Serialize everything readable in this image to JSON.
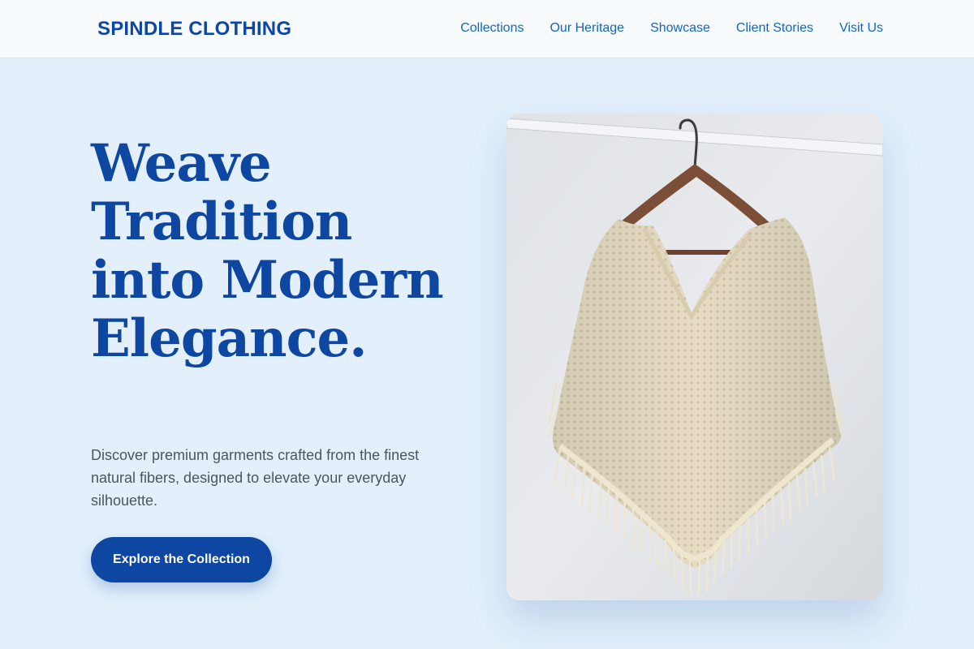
{
  "brand": {
    "name": "SPINDLE CLOTHING"
  },
  "nav": {
    "items": [
      "Collections",
      "Our Heritage",
      "Showcase",
      "Client Stories",
      "Visit Us"
    ]
  },
  "hero": {
    "title": "Weave Tradition into Modern Elegance.",
    "description": "Discover premium garments crafted from the finest natural fibers, designed to elevate your everyday silhouette.",
    "cta_label": "Explore the Collection"
  },
  "colors": {
    "accent": "#0d47a1",
    "nav_link": "#1565c0",
    "page_background": "#e3f0fc",
    "body_text": "#4a5563"
  },
  "image": {
    "subject": "cream knit fringed poncho on a wooden hanger"
  }
}
